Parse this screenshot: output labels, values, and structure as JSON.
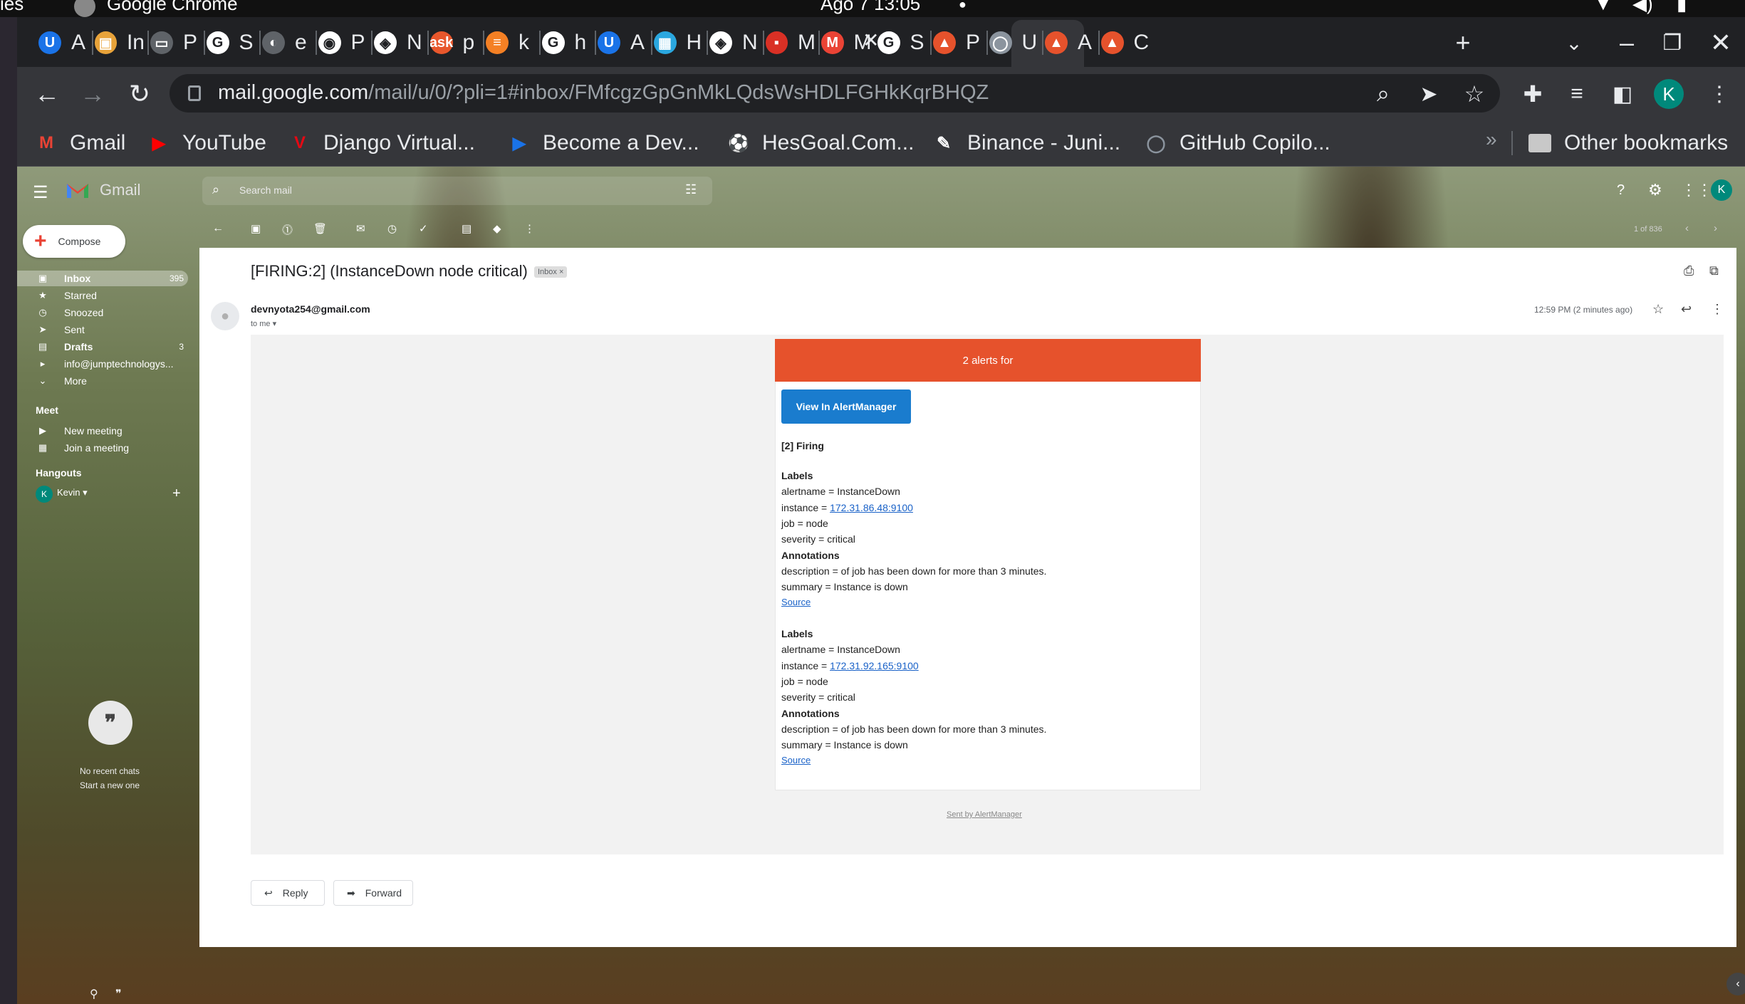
{
  "os_bar": {
    "left_text": "ies",
    "app": "Google Chrome",
    "clock": "Ago 7  13:05"
  },
  "tabs": [
    {
      "letter": "A",
      "icon": "U",
      "color": "#1a73e8"
    },
    {
      "letter": "In",
      "icon": "▣",
      "color": "#e8a33a"
    },
    {
      "letter": "P",
      "icon": "▭",
      "color": "#5f6368"
    },
    {
      "letter": "S",
      "icon": "G",
      "color": "#ffffff"
    },
    {
      "letter": "e",
      "icon": "◐",
      "color": "#5f6368"
    },
    {
      "letter": "P",
      "icon": "◉",
      "color": "#ffffff"
    },
    {
      "letter": "N",
      "icon": "◈",
      "color": "#ffffff"
    },
    {
      "letter": "p",
      "icon": "ask",
      "color": "#e8572c"
    },
    {
      "letter": "k",
      "icon": "≡",
      "color": "#f48024"
    },
    {
      "letter": "h",
      "icon": "G",
      "color": "#ffffff"
    },
    {
      "letter": "A",
      "icon": "U",
      "color": "#1a73e8"
    },
    {
      "letter": "H",
      "icon": "▦",
      "color": "#2aa7df"
    },
    {
      "letter": "N",
      "icon": "◈",
      "color": "#ffffff"
    },
    {
      "letter": "M",
      "icon": "▪",
      "color": "#d93025"
    },
    {
      "letter": "M",
      "icon": "M",
      "color": "#ea4335"
    },
    {
      "letter": "S",
      "icon": "G",
      "color": "#ffffff"
    },
    {
      "letter": "P",
      "icon": "▲",
      "color": "#e6522c"
    },
    {
      "letter": "U",
      "icon": "◯",
      "color": "#8b949e"
    },
    {
      "letter": "A",
      "icon": "▲",
      "color": "#e6522c"
    },
    {
      "letter": "C",
      "icon": "▲",
      "color": "#e6522c"
    }
  ],
  "toolbar": {
    "url_host": "mail.google.com",
    "url_path": "/mail/u/0/?pli=1#inbox/FMfcgzGpGnMkLQdsWsHDLFGHkKqrBHQZ",
    "profile_letter": "K"
  },
  "bookmarks": [
    {
      "label": "Gmail",
      "icon": "M",
      "color": "#ea4335"
    },
    {
      "label": "YouTube",
      "icon": "▶",
      "color": "#ff0000"
    },
    {
      "label": "Django Virtual...",
      "icon": "V",
      "color": "#e50914"
    },
    {
      "label": "Become a Dev...",
      "icon": "▶",
      "color": "#1a73e8"
    },
    {
      "label": "HesGoal.Com...",
      "icon": "⚽",
      "color": "#ffffff"
    },
    {
      "label": "Binance - Juni...",
      "icon": "✎",
      "color": "#ffffff"
    },
    {
      "label": "GitHub Copilo...",
      "icon": "◯",
      "color": "#8b949e"
    }
  ],
  "bookmarks_more": "»",
  "other_bookmarks": "Other bookmarks",
  "gmail": {
    "logo_text": "Gmail",
    "search_placeholder": "Search mail",
    "compose": "Compose",
    "avatar_letter": "K",
    "page_count": "1 of 836",
    "nav": [
      {
        "label": "Inbox",
        "icon": "▣",
        "count": "395",
        "bold": true
      },
      {
        "label": "Starred",
        "icon": "★",
        "count": ""
      },
      {
        "label": "Snoozed",
        "icon": "◷",
        "count": ""
      },
      {
        "label": "Sent",
        "icon": "➤",
        "count": ""
      },
      {
        "label": "Drafts",
        "icon": "▤",
        "count": "3",
        "bold": true
      },
      {
        "label": "info@jumptechnologys...",
        "icon": "▸",
        "count": ""
      },
      {
        "label": "More",
        "icon": "⌄",
        "count": ""
      }
    ],
    "meet_heading": "Meet",
    "meet_items": [
      {
        "label": "New meeting",
        "icon": "▶"
      },
      {
        "label": "Join a meeting",
        "icon": "▦"
      }
    ],
    "hangouts_heading": "Hangouts",
    "hangouts_user": "Kevin",
    "no_chats": "No recent chats",
    "start_new": "Start a new one"
  },
  "email": {
    "subject": "[FIRING:2] (InstanceDown node critical)",
    "label_chip": "Inbox",
    "sender": "devnyota254@gmail.com",
    "to": "to me",
    "time": "12:59 PM (2 minutes ago)",
    "reply": "Reply",
    "forward": "Forward"
  },
  "alert": {
    "header": "2 alerts for",
    "button": "View In AlertManager",
    "firing": "[2] Firing",
    "labels_heading": "Labels",
    "annotations_heading": "Annotations",
    "source": "Source",
    "footer": "Sent by AlertManager",
    "alerts": [
      {
        "alertname": "alertname = InstanceDown",
        "instance_prefix": "instance = ",
        "instance": "172.31.86.48:9100",
        "job": "job = node",
        "severity": "severity = critical",
        "description": "description = of job has been down for more than 3 minutes.",
        "summary": "summary = Instance is down"
      },
      {
        "alertname": "alertname = InstanceDown",
        "instance_prefix": "instance = ",
        "instance": "172.31.92.165:9100",
        "job": "job = node",
        "severity": "severity = critical",
        "description": "description = of job has been down for more than 3 minutes.",
        "summary": "summary = Instance is down"
      }
    ]
  }
}
